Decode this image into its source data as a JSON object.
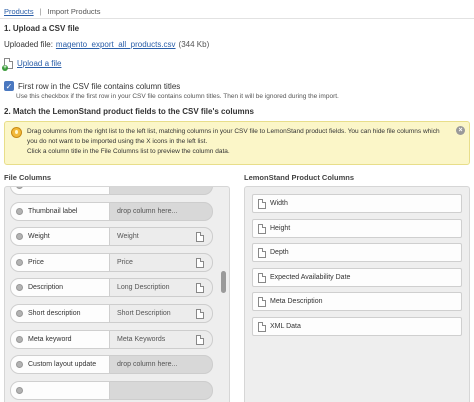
{
  "breadcrumb": {
    "link": "Products",
    "current": "Import Products"
  },
  "step1": {
    "title": "1. Upload a CSV file",
    "uploaded_label": "Uploaded file:",
    "file_name": "magento_export_all_products.csv",
    "file_size": "(344 Kb)",
    "upload_link": "Upload a file"
  },
  "checkbox": {
    "label": "First row in the CSV file contains column titles",
    "help": "Use this checkbox if the first row in your CSV file contains column titles. Then it will be ignored during the import.",
    "checked": true
  },
  "step2": {
    "title": "2. Match the LemonStand product fields to the CSV file's columns"
  },
  "hint": {
    "line1": "Drag columns from the right list to the left list, matching columns in your CSV file to LemonStand product fields. You can hide file columns which you do not want to be imported using the X icons in the left list.",
    "line2": "Click a column title in the File Columns list to preview the column data."
  },
  "file_columns": {
    "header": "File Columns",
    "rows": [
      {
        "name": "",
        "mapped": ""
      },
      {
        "name": "Thumbnail label",
        "mapped": "",
        "placeholder": "drop column here..."
      },
      {
        "name": "Weight",
        "mapped": "Weight"
      },
      {
        "name": "Price",
        "mapped": "Price"
      },
      {
        "name": "Description",
        "mapped": "Long Description"
      },
      {
        "name": "Short description",
        "mapped": "Short Description"
      },
      {
        "name": "Meta keyword",
        "mapped": "Meta Keywords"
      },
      {
        "name": "Custom layout update",
        "mapped": "",
        "placeholder": "drop column here..."
      },
      {
        "name": "",
        "mapped": ""
      }
    ]
  },
  "lemonstand_columns": {
    "header": "LemonStand Product Columns",
    "items": [
      "Width",
      "Height",
      "Depth",
      "Expected Availability Date",
      "Meta Description",
      "XML Data"
    ]
  },
  "colors": {
    "link": "#2a5ea8",
    "hint_bg": "#fbf6c8",
    "panel_bg": "#eeeeee"
  }
}
